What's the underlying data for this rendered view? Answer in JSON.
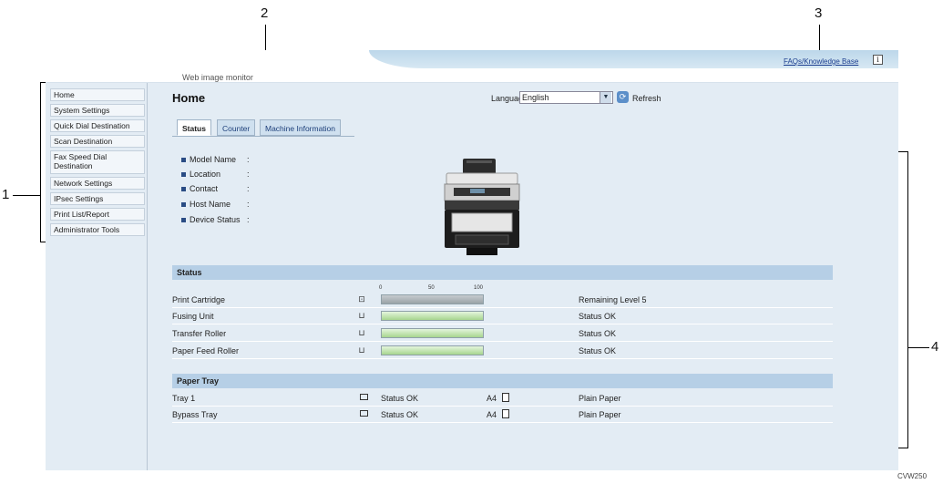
{
  "callouts": {
    "one": "1",
    "two": "2",
    "three": "3",
    "four": "4"
  },
  "header": {
    "brand": "Web image monitor",
    "faq_link": "FAQs/Knowledge Base",
    "info_icon": "i"
  },
  "sidebar": {
    "items": [
      {
        "label": "Home"
      },
      {
        "label": "System Settings"
      },
      {
        "label": "Quick Dial Destination"
      },
      {
        "label": "Scan Destination"
      },
      {
        "label": "Fax Speed Dial Destination"
      },
      {
        "label": "Network Settings"
      },
      {
        "label": "IPsec Settings"
      },
      {
        "label": "Print List/Report"
      },
      {
        "label": "Administrator Tools"
      }
    ]
  },
  "main": {
    "title": "Home",
    "language_label": "Language",
    "language_value": "English",
    "refresh_label": "Refresh",
    "tabs": [
      {
        "label": "Status"
      },
      {
        "label": "Counter"
      },
      {
        "label": "Machine Information"
      }
    ],
    "device_info": [
      {
        "label": "Model Name",
        "colon": ":"
      },
      {
        "label": "Location",
        "colon": ":"
      },
      {
        "label": "Contact",
        "colon": ":"
      },
      {
        "label": "Host Name",
        "colon": ":"
      },
      {
        "label": "Device Status",
        "colon": ":"
      }
    ]
  },
  "status_section": {
    "title": "Status",
    "scale": [
      "0",
      "50",
      "100"
    ],
    "rows": [
      {
        "name": "Print Cartridge",
        "status": "Remaining Level 5",
        "level_pct": 100
      },
      {
        "name": "Fusing Unit",
        "status": "Status OK",
        "level_pct": 100
      },
      {
        "name": "Transfer Roller",
        "status": "Status OK",
        "level_pct": 100
      },
      {
        "name": "Paper Feed Roller",
        "status": "Status OK",
        "level_pct": 100
      }
    ]
  },
  "paper_tray_section": {
    "title": "Paper Tray",
    "rows": [
      {
        "name": "Tray 1",
        "status": "Status OK",
        "size": "A4",
        "type": "Plain Paper"
      },
      {
        "name": "Bypass Tray",
        "status": "Status OK",
        "size": "A4",
        "type": "Plain Paper"
      }
    ]
  },
  "footer": {
    "code": "CVW250"
  },
  "colors": {
    "accent": "#b6cfe6",
    "bar_green": "#a7d58e",
    "bar_gray": "#9aa3a8",
    "link": "#1a3d8f"
  },
  "icons": {
    "refresh": "refresh-icon",
    "dropdown": "chevron-down-icon",
    "cartridge": "toner-icon",
    "unit": "tray-icon",
    "paper": "paper-icon"
  }
}
